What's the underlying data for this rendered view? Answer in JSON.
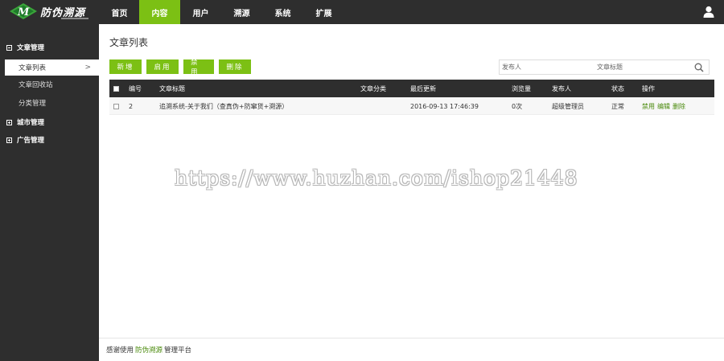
{
  "app": {
    "logo_text": "防伪溯源",
    "brand_color": "#7cc014",
    "dark_color": "#2e2e2e"
  },
  "nav": {
    "items": [
      {
        "label": "首页"
      },
      {
        "label": "内容",
        "active": true
      },
      {
        "label": "用户"
      },
      {
        "label": "溯源"
      },
      {
        "label": "系统"
      },
      {
        "label": "扩展"
      }
    ],
    "user_icon": "user-icon"
  },
  "sidebar": {
    "groups": [
      {
        "label": "文章管理",
        "expanded": true,
        "items": [
          {
            "label": "文章列表",
            "active": true
          },
          {
            "label": "文章回收站"
          },
          {
            "label": "分类管理"
          }
        ]
      },
      {
        "label": "城市管理",
        "expanded": false
      },
      {
        "label": "广告管理",
        "expanded": false
      }
    ]
  },
  "main": {
    "title": "文章列表",
    "buttons": {
      "add": "新增",
      "enable": "启用",
      "disable": "禁用",
      "delete": "删除"
    },
    "search": {
      "publisher_placeholder": "发布人",
      "title_placeholder": "文章标题"
    },
    "table": {
      "headers": [
        "编号",
        "文章标题",
        "文章分类",
        "最后更新",
        "浏览量",
        "发布人",
        "状态",
        "操作"
      ],
      "rows": [
        {
          "id": "2",
          "title": "追溯系统-关于我们（查真伪+防窜货+溯源）",
          "category": "",
          "updated": "2016-09-13 17:46:39",
          "views": "0次",
          "publisher": "超级管理员",
          "status": "正常",
          "ops": [
            "禁用",
            "编辑",
            "删除"
          ]
        }
      ]
    }
  },
  "watermark": "https://www.huzhan.com/ishop21448",
  "footer": {
    "prefix": "感谢使用",
    "brand": "防伪溯源",
    "suffix": "管理平台"
  }
}
